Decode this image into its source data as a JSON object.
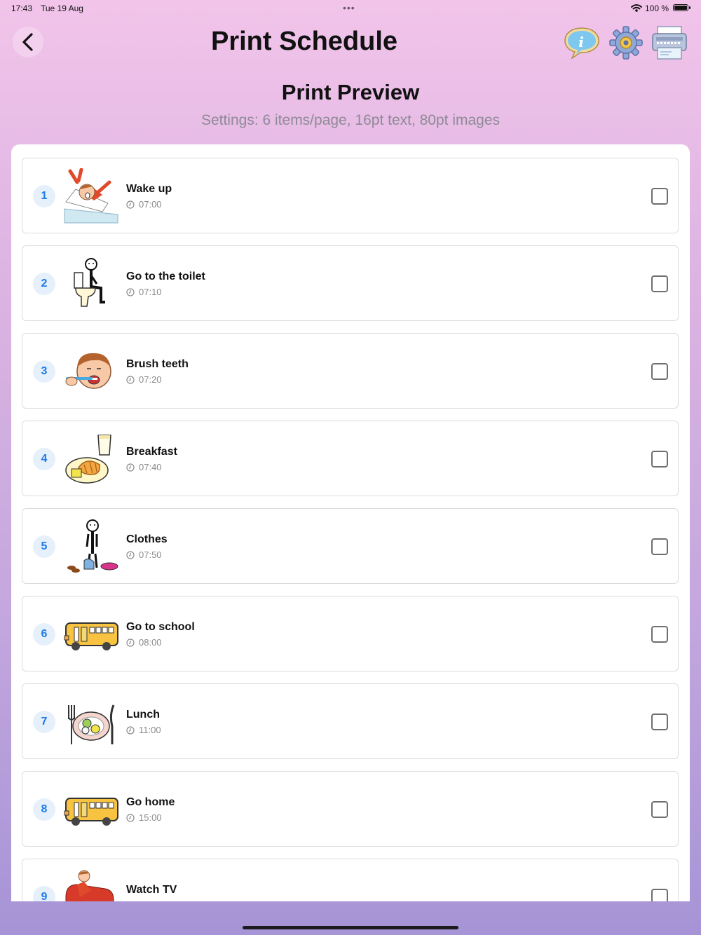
{
  "status": {
    "time": "17:43",
    "date": "Tue 19 Aug",
    "battery": "100 %",
    "battery_level": 1.0,
    "dots": "•••"
  },
  "header": {
    "title": "Print Schedule"
  },
  "toolbar": {
    "info_icon": "info-speech-bubble-icon",
    "settings_icon": "gear-icon",
    "print_icon": "printer-icon"
  },
  "preview": {
    "title": "Print Preview",
    "settings_text": "Settings: 6 items/page, 16pt text, 80pt images"
  },
  "items": [
    {
      "number": "1",
      "title": "Wake up",
      "time": "07:00",
      "icon": "wake-up-icon",
      "checked": false
    },
    {
      "number": "2",
      "title": "Go to the toilet",
      "time": "07:10",
      "icon": "toilet-icon",
      "checked": false
    },
    {
      "number": "3",
      "title": "Brush teeth",
      "time": "07:20",
      "icon": "brush-teeth-icon",
      "checked": false
    },
    {
      "number": "4",
      "title": "Breakfast",
      "time": "07:40",
      "icon": "breakfast-icon",
      "checked": false
    },
    {
      "number": "5",
      "title": "Clothes",
      "time": "07:50",
      "icon": "clothes-icon",
      "checked": false
    },
    {
      "number": "6",
      "title": "Go to school",
      "time": "08:00",
      "icon": "school-bus-icon",
      "checked": false
    },
    {
      "number": "7",
      "title": "Lunch",
      "time": "11:00",
      "icon": "lunch-plate-icon",
      "checked": false
    },
    {
      "number": "8",
      "title": "Go home",
      "time": "15:00",
      "icon": "school-bus-icon",
      "checked": false
    },
    {
      "number": "9",
      "title": "Watch TV",
      "time": "",
      "icon": "watch-tv-icon",
      "checked": false
    }
  ],
  "colors": {
    "accent": "#1f7ae6",
    "badge_bg": "#e6f0fb",
    "bus_yellow": "#f7c340"
  }
}
